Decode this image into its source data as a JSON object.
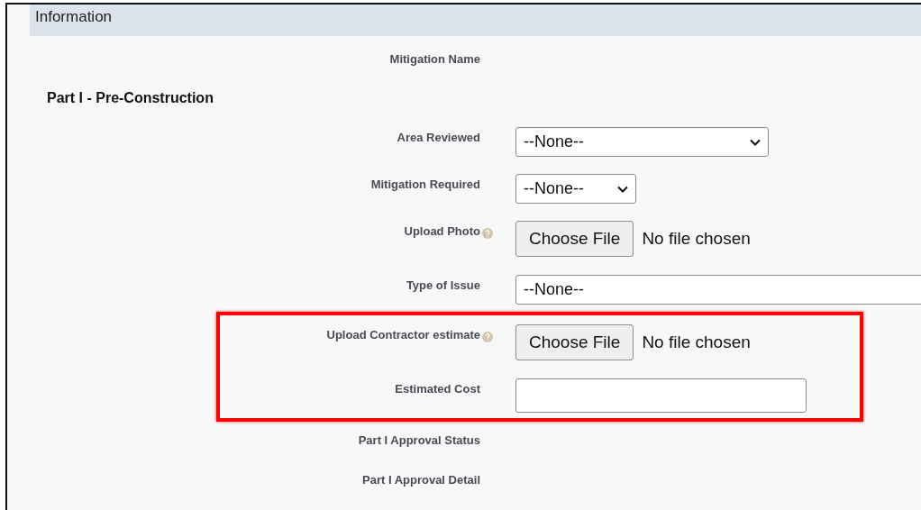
{
  "section": {
    "title": "Information"
  },
  "rows": [
    {
      "kind": "text",
      "label": "Mitigation Name",
      "help": false
    },
    {
      "kind": "heading",
      "label": "Part I - Pre-Construction"
    },
    {
      "kind": "select",
      "label": "Area Reviewed",
      "help": false,
      "value": "--None--"
    },
    {
      "kind": "select",
      "label": "Mitigation Required",
      "help": false,
      "value": "--None--"
    },
    {
      "kind": "file",
      "label": "Upload Photo",
      "help": true,
      "button": "Choose File",
      "status": "No file chosen"
    },
    {
      "kind": "select",
      "label": "Type of Issue",
      "help": false,
      "value": "--None--"
    },
    {
      "kind": "group",
      "highlighted": true,
      "rows": [
        {
          "kind": "file",
          "label": "Upload Contractor estimate",
          "help": true,
          "button": "Choose File",
          "status": "No file chosen"
        },
        {
          "kind": "input",
          "label": "Estimated Cost",
          "help": false
        }
      ]
    },
    {
      "kind": "text",
      "label": "Part I Approval Status",
      "help": false
    },
    {
      "kind": "text",
      "label": "Part I Approval Detail",
      "help": false
    }
  ]
}
